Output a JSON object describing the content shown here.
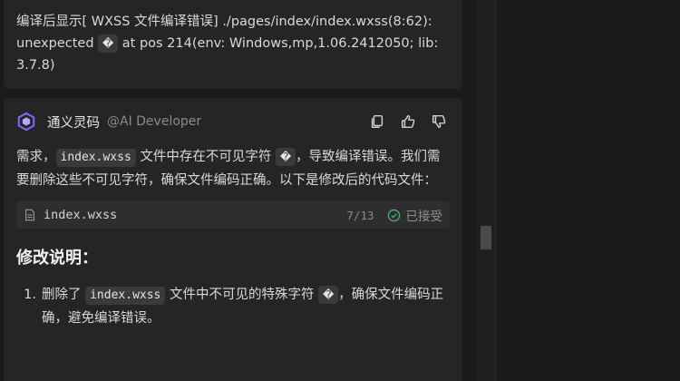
{
  "previous_message": {
    "line1": "编译后显示[ WXSS 文件编译错误] ./pages/index/index.wxss(8:62):",
    "line2_prefix": "unexpected ",
    "glyph": "�",
    "line2_suffix": " at pos 214(env: Windows,mp,1.06.2412050; lib:",
    "line3": "3.7.8)"
  },
  "assistant": {
    "name": "通义灵码",
    "handle": "@AI Developer",
    "icons": [
      "copy-icon",
      "thumbs-up-icon",
      "thumbs-down-icon"
    ],
    "accent": "#7b6cf6"
  },
  "reply": {
    "p_part1": "需求，",
    "p_code": "index.wxss",
    "p_part2": " 文件中存在不可见字符 ",
    "p_glyph": "�",
    "p_part3": "，导致编译错误。我们需要删除这些不可见字符，确保文件编码正确。以下是修改后的代码文件：",
    "file": {
      "icon": "file-icon",
      "name": "index.wxss",
      "count": "7/13",
      "status": "已接受",
      "status_icon": "check-circle-icon"
    },
    "section_title": "修改说明：",
    "list": [
      {
        "num": "1.",
        "part1": "删除了 ",
        "code": "index.wxss",
        "part2": " 文件中不可见的特殊字符 ",
        "glyph": "�",
        "part3": "，确保文件编码正确，避免编译错误。"
      }
    ]
  }
}
